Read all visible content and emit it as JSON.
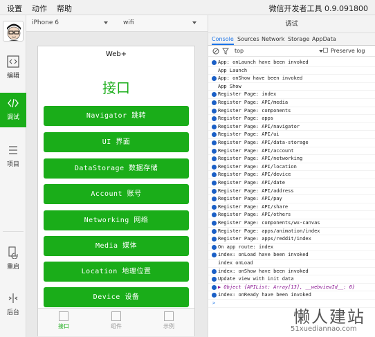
{
  "menubar": {
    "items": [
      "设置",
      "动作",
      "帮助"
    ],
    "app_title": "微信开发者工具 0.9.091800"
  },
  "sidebar": {
    "items": [
      {
        "label": "编辑",
        "icon": "code-file-icon"
      },
      {
        "label": "调试",
        "icon": "debug-code-icon"
      },
      {
        "label": "项目",
        "icon": "list-icon"
      },
      {
        "label": "重启",
        "icon": "restart-icon"
      },
      {
        "label": "后台",
        "icon": "background-icon"
      }
    ],
    "active": "调试"
  },
  "device_bar": {
    "device": "iPhone 6",
    "network": "wifi"
  },
  "phone": {
    "title": "Web+",
    "heading": "接口",
    "buttons": [
      "Navigator 跳转",
      "UI 界面",
      "DataStorage 数据存储",
      "Account 账号",
      "Networking 网络",
      "Media 媒体",
      "Location 地理位置",
      "Device 设备"
    ],
    "tabs": [
      {
        "label": "接口",
        "active": true
      },
      {
        "label": "组件",
        "active": false
      },
      {
        "label": "示例",
        "active": false
      }
    ]
  },
  "debugger": {
    "header": "调试",
    "tabs": [
      "Console",
      "Sources",
      "Network",
      "Storage",
      "AppData"
    ],
    "active_tab": "Console",
    "context": "top",
    "preserve_log_label": "Preserve log",
    "logs": [
      {
        "type": "info",
        "text": "App: onLaunch have been invoked"
      },
      {
        "type": "plain",
        "text": "App Launch"
      },
      {
        "type": "info",
        "text": "App: onShow have been invoked"
      },
      {
        "type": "plain",
        "text": "App Show"
      },
      {
        "type": "info",
        "text": "Register Page: index"
      },
      {
        "type": "info",
        "text": "Register Page: API/media"
      },
      {
        "type": "info",
        "text": "Register Page: components"
      },
      {
        "type": "info",
        "text": "Register Page: apps"
      },
      {
        "type": "info",
        "text": "Register Page: API/navigator"
      },
      {
        "type": "info",
        "text": "Register Page: API/ui"
      },
      {
        "type": "info",
        "text": "Register Page: API/data-storage"
      },
      {
        "type": "info",
        "text": "Register Page: API/account"
      },
      {
        "type": "info",
        "text": "Register Page: API/networking"
      },
      {
        "type": "info",
        "text": "Register Page: API/location"
      },
      {
        "type": "info",
        "text": "Register Page: API/device"
      },
      {
        "type": "info",
        "text": "Register Page: API/date"
      },
      {
        "type": "info",
        "text": "Register Page: API/address"
      },
      {
        "type": "info",
        "text": "Register Page: API/pay"
      },
      {
        "type": "info",
        "text": "Register Page: API/share"
      },
      {
        "type": "info",
        "text": "Register Page: API/others"
      },
      {
        "type": "info",
        "text": "Register Page: components/wx-canvas"
      },
      {
        "type": "info",
        "text": "Register Page: apps/animation/index"
      },
      {
        "type": "info",
        "text": "Register Page: apps/reddit/index"
      },
      {
        "type": "info",
        "text": "On app route: index"
      },
      {
        "type": "info",
        "text": "index: onLoad have been invoked"
      },
      {
        "type": "plain",
        "text": "index onLoad"
      },
      {
        "type": "info",
        "text": "index: onShow have been invoked"
      },
      {
        "type": "info",
        "text": "Update view with init data"
      },
      {
        "type": "object",
        "text": "▶ Object {APIList: Array[13], __webviewId__: 0}"
      },
      {
        "type": "info",
        "text": "index: onReady have been invoked"
      },
      {
        "type": "prompt",
        "text": ">"
      }
    ]
  },
  "watermark": {
    "main": "懒人建站",
    "sub": "51xuediannao.com"
  },
  "colors": {
    "accent_green": "#1aad19",
    "info_blue": "#1a5fc6",
    "tab_active_blue": "#1a73e8"
  }
}
